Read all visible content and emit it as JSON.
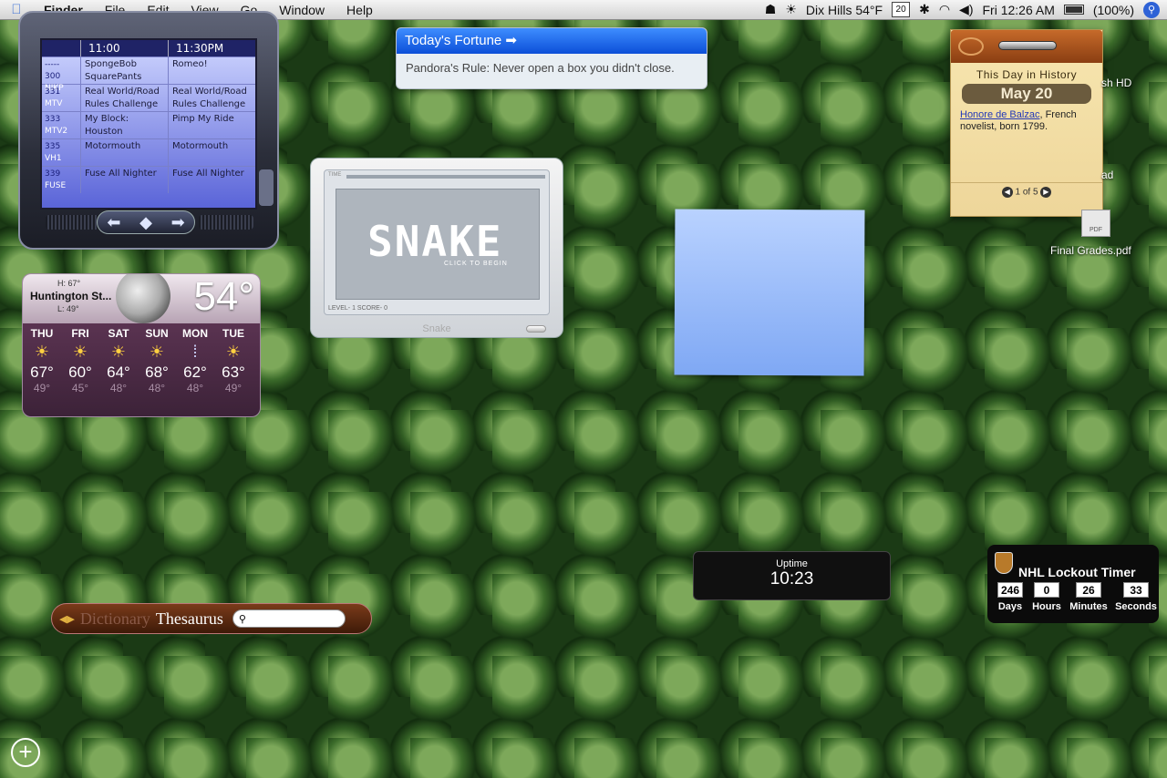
{
  "menubar": {
    "app": "Finder",
    "items": [
      "File",
      "Edit",
      "View",
      "Go",
      "Window",
      "Help"
    ],
    "weather_status": "Dix Hills 54°F",
    "calendar_day": "20",
    "time": "Fri 12:26 AM",
    "battery": "(100%)",
    "icons": [
      "apple-icon",
      "robot-icon",
      "sun-icon",
      "calendar-icon",
      "bluetooth-icon",
      "wifi-icon",
      "volume-icon",
      "battery-icon",
      "spotlight-icon"
    ]
  },
  "tv": {
    "times": [
      "11:00",
      "11:30PM"
    ],
    "rows": [
      {
        "num": "300",
        "net": "NIKP",
        "a": "SpongeBob SquarePants",
        "b": "Romeo!"
      },
      {
        "num": "331",
        "net": "MTV",
        "a": "Real World/Road Rules Challenge",
        "b": "Real World/Road Rules Challenge"
      },
      {
        "num": "333",
        "net": "MTV2",
        "a": "My Block: Houston",
        "b": "Pimp My Ride"
      },
      {
        "num": "335",
        "net": "VH1",
        "a": "Motormouth",
        "b": "Motormouth"
      },
      {
        "num": "339",
        "net": "FUSE",
        "a": "Fuse All Nighter",
        "b": "Fuse All Nighter"
      }
    ],
    "top_marker": "-----"
  },
  "fortune": {
    "title": "Today's Fortune",
    "text": "Pandora's Rule: Never open a box you didn't close."
  },
  "history": {
    "label": "This Day in History",
    "date": "May 20",
    "link": "Honore de Balzac",
    "text": ", French novelist, born 1799.",
    "pager": "1 of 5"
  },
  "desktop": {
    "hd_label": "sh HD",
    "d_label": "ad",
    "pdf_label": "Final Grades.pdf",
    "pdf_icon_text": "PDF"
  },
  "snake": {
    "time_label": "TIME",
    "logo": "SNAKE",
    "click": "CLICK TO BEGIN",
    "status": "LEVEL- 1  SCORE- 0",
    "name": "Snake"
  },
  "weather": {
    "high": "H: 67°",
    "city": "Huntington St...",
    "low": "L: 49°",
    "temp": "54°",
    "days": [
      {
        "name": "THU",
        "hi": "67°",
        "lo": "49°",
        "icon": "sun-icon"
      },
      {
        "name": "FRI",
        "hi": "60°",
        "lo": "45°",
        "icon": "sun-icon"
      },
      {
        "name": "SAT",
        "hi": "64°",
        "lo": "48°",
        "icon": "sun-icon"
      },
      {
        "name": "SUN",
        "hi": "68°",
        "lo": "48°",
        "icon": "sun-icon"
      },
      {
        "name": "MON",
        "hi": "62°",
        "lo": "48°",
        "icon": "rain-icon"
      },
      {
        "name": "TUE",
        "hi": "63°",
        "lo": "49°",
        "icon": "sun-icon"
      }
    ]
  },
  "dictionary": {
    "dict": "Dictionary",
    "thes": "Thesaurus",
    "search_value": ""
  },
  "uptime": {
    "label": "Uptime",
    "value": "10:23"
  },
  "nhl": {
    "title": "NHL Lockout  Timer",
    "units": [
      {
        "value": "246",
        "label": "Days"
      },
      {
        "value": "0",
        "label": "Hours"
      },
      {
        "value": "26",
        "label": "Minutes"
      },
      {
        "value": "33",
        "label": "Seconds"
      }
    ]
  },
  "dashboard": {
    "add_symbol": "+"
  }
}
